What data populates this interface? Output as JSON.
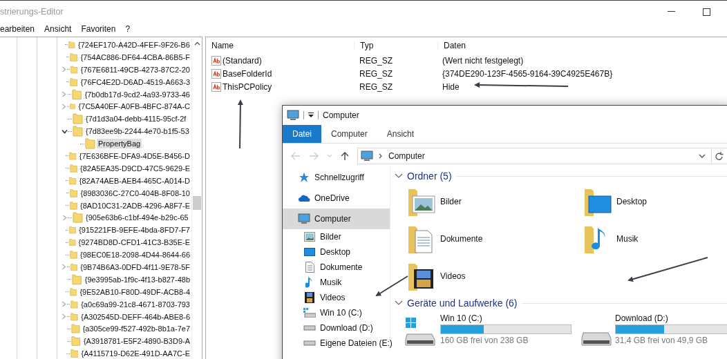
{
  "regedit": {
    "title": "strierungs-Editor",
    "menu": [
      "earbeiten",
      "Ansicht",
      "Favoriten",
      "?"
    ],
    "tree": [
      {
        "label": "{724EF170-A42D-4FEF-9F26-B6",
        "selected": false
      },
      {
        "label": "{754AC886-DF64-4CBA-86B5-F",
        "selected": false
      },
      {
        "label": "{767E6811-49CB-4273-87C2-20",
        "expanded": false,
        "selected": false
      },
      {
        "label": "{76FC4E2D-D6AD-4519-A663-3",
        "selected": false
      },
      {
        "label": "{7b0db17d-9cd2-4a93-9733-46",
        "expanded": false,
        "selected": false
      },
      {
        "label": "{7C5A40EF-A0FB-4BFC-874A-C",
        "expanded": false,
        "selected": false
      },
      {
        "label": "{7d1d3a04-debb-4115-95cf-2f",
        "selected": false
      },
      {
        "label": "{7d83ee9b-2244-4e70-b1f5-53",
        "expanded": true,
        "selected": false,
        "children": [
          {
            "label": "PropertyBag",
            "selected": true
          }
        ]
      },
      {
        "label": "{7E636BFE-DFA9-4D5E-B456-D",
        "selected": false
      },
      {
        "label": "{82A5EA35-D9CD-47C5-9629-E",
        "selected": false
      },
      {
        "label": "{82A74AEB-AEB4-465C-A014-D",
        "selected": false
      },
      {
        "label": "{8983036C-27C0-404B-8F08-10",
        "selected": false
      },
      {
        "label": "{8AD10C31-2ADB-4296-A8F7-E",
        "selected": false
      },
      {
        "label": "{905e63b6-c1bf-494e-b29c-65",
        "expanded": false,
        "selected": false
      },
      {
        "label": "{915221FB-9EFE-4bda-8FD7-F7",
        "selected": false
      },
      {
        "label": "{9274BD8D-CFD1-41C3-B35E-E",
        "selected": false
      },
      {
        "label": "{98EC0E18-2098-4D44-8644-66",
        "selected": false
      },
      {
        "label": "{9B74B6A3-0DFD-4f11-9E78-5F",
        "expanded": false,
        "selected": false
      },
      {
        "label": "{9e3995ab-1f9c-4f13-b827-48b",
        "selected": false
      },
      {
        "label": "{9E52AB10-F80D-49DF-ACB8-4",
        "selected": false
      },
      {
        "label": "{a0c69a99-21c8-4671-8703-793",
        "expanded": false,
        "selected": false
      },
      {
        "label": "{A302545D-DEFF-464b-ABE8-6",
        "expanded": false,
        "selected": false
      },
      {
        "label": "{a305ce99-f527-492b-8b1a-7e7",
        "selected": false
      },
      {
        "label": "{A3918781-E5F2-4890-B3D9-A",
        "selected": false
      },
      {
        "label": "{A4115719-D62E-491D-AA7C-E",
        "selected": false
      }
    ],
    "values": {
      "columns": [
        "Name",
        "Typ",
        "Daten"
      ],
      "rows": [
        {
          "name": "(Standard)",
          "type": "REG_SZ",
          "data": "(Wert nicht festgelegt)"
        },
        {
          "name": "BaseFolderId",
          "type": "REG_SZ",
          "data": "{374DE290-123F-4565-9164-39C4925E467B}"
        },
        {
          "name": "ThisPCPolicy",
          "type": "REG_SZ",
          "data": "Hide"
        }
      ]
    }
  },
  "explorer": {
    "title": "Computer",
    "tabs": [
      {
        "label": "Datei",
        "selected": true
      },
      {
        "label": "Computer",
        "selected": false
      },
      {
        "label": "Ansicht",
        "selected": false
      }
    ],
    "address": "Computer",
    "sidebar": [
      {
        "label": "Schnellzugriff",
        "kind": "star",
        "selected": false
      },
      {
        "label": "OneDrive",
        "kind": "cloud",
        "selected": false
      },
      {
        "label": "Computer",
        "kind": "pc",
        "selected": true,
        "children": [
          {
            "label": "Bilder",
            "kind": "pictures",
            "selected": false
          },
          {
            "label": "Desktop",
            "kind": "desktop",
            "selected": false
          },
          {
            "label": "Dokumente",
            "kind": "documents",
            "selected": false
          },
          {
            "label": "Musik",
            "kind": "music",
            "selected": false
          },
          {
            "label": "Videos",
            "kind": "videos",
            "selected": false
          },
          {
            "label": "Win 10 (C:)",
            "kind": "windows-drive",
            "selected": false
          },
          {
            "label": "Download (D:)",
            "kind": "drive",
            "selected": false
          },
          {
            "label": "Eigene Dateien (E:)",
            "kind": "drive",
            "selected": false
          }
        ]
      }
    ],
    "folders_heading": "Ordner (5)",
    "folders": [
      {
        "label": "Bilder",
        "kind": "pictures"
      },
      {
        "label": "Desktop",
        "kind": "desktop"
      },
      {
        "label": "Dokumente",
        "kind": "documents"
      },
      {
        "label": "Musik",
        "kind": "music"
      },
      {
        "label": "Videos",
        "kind": "videos"
      }
    ],
    "drives_heading": "Geräte und Laufwerke (6)",
    "drives": [
      {
        "label": "Win 10 (C:)",
        "kind": "windows-drive",
        "level": 0.33,
        "free": "160 GB frei von 238 GB"
      },
      {
        "label": "Download (D:)",
        "kind": "drive",
        "level": 0.37,
        "free": "31,4 GB frei von 49,9 GB"
      }
    ]
  }
}
